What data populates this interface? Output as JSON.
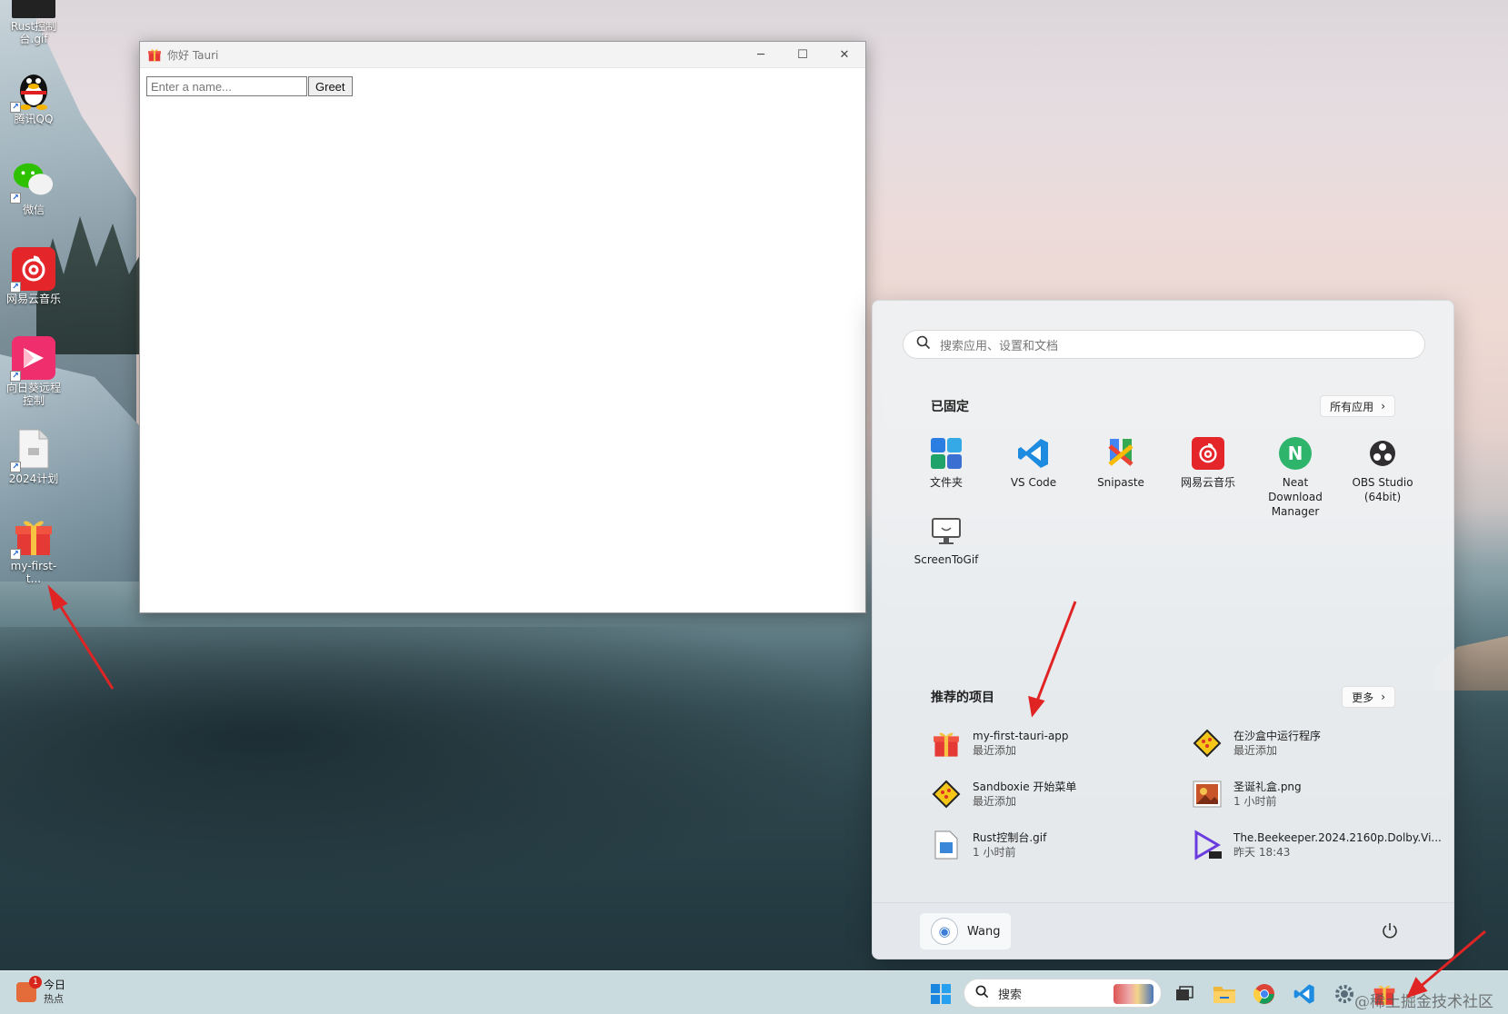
{
  "desktop": {
    "icons": [
      {
        "label": "Rust控制台.gif",
        "name": "rust-gif"
      },
      {
        "label": "腾讯QQ",
        "name": "qq"
      },
      {
        "label": "微信",
        "name": "wechat"
      },
      {
        "label": "网易云音乐",
        "name": "netease-music"
      },
      {
        "label": "向日葵远程控制",
        "name": "sunlogin"
      },
      {
        "label": "2024计划",
        "name": "plan-2024"
      },
      {
        "label": "my-first-t...",
        "name": "my-first-tauri"
      }
    ]
  },
  "window": {
    "title": "你好 Tauri",
    "input_placeholder": "Enter a name...",
    "greet_label": "Greet"
  },
  "start_menu": {
    "search_placeholder": "搜索应用、设置和文档",
    "pinned_title": "已固定",
    "all_apps_label": "所有应用",
    "pinned": [
      {
        "label": "文件夹",
        "icon": "folder-icon"
      },
      {
        "label": "VS Code",
        "icon": "vscode-icon"
      },
      {
        "label": "Snipaste",
        "icon": "snipaste-icon"
      },
      {
        "label": "网易云音乐",
        "icon": "netease-icon"
      },
      {
        "label": "Neat Download Manager",
        "icon": "ndm-icon"
      },
      {
        "label": "OBS Studio (64bit)",
        "icon": "obs-icon"
      },
      {
        "label": "ScreenToGif",
        "icon": "screentogif-icon"
      }
    ],
    "recommended_title": "推荐的项目",
    "more_label": "更多",
    "recommended": [
      {
        "title": "my-first-tauri-app",
        "sub": "最近添加",
        "icon": "gift-icon"
      },
      {
        "title": "在沙盒中运行程序",
        "sub": "最近添加",
        "icon": "sandboxie-icon"
      },
      {
        "title": "Sandboxie 开始菜单",
        "sub": "最近添加",
        "icon": "sandboxie-icon"
      },
      {
        "title": "圣诞礼盒.png",
        "sub": "1 小时前",
        "icon": "image-icon"
      },
      {
        "title": "Rust控制台.gif",
        "sub": "1 小时前",
        "icon": "gif-file-icon"
      },
      {
        "title": "The.Beekeeper.2024.2160p.Dolby.Vi...",
        "sub": "昨天 18:43",
        "icon": "video-icon"
      }
    ],
    "user_name": "Wang"
  },
  "taskbar": {
    "news_badge": "1",
    "news_title": "今日",
    "news_sub": "热点",
    "search_label": "搜索"
  },
  "watermark": "@稀土掘金技术社区"
}
